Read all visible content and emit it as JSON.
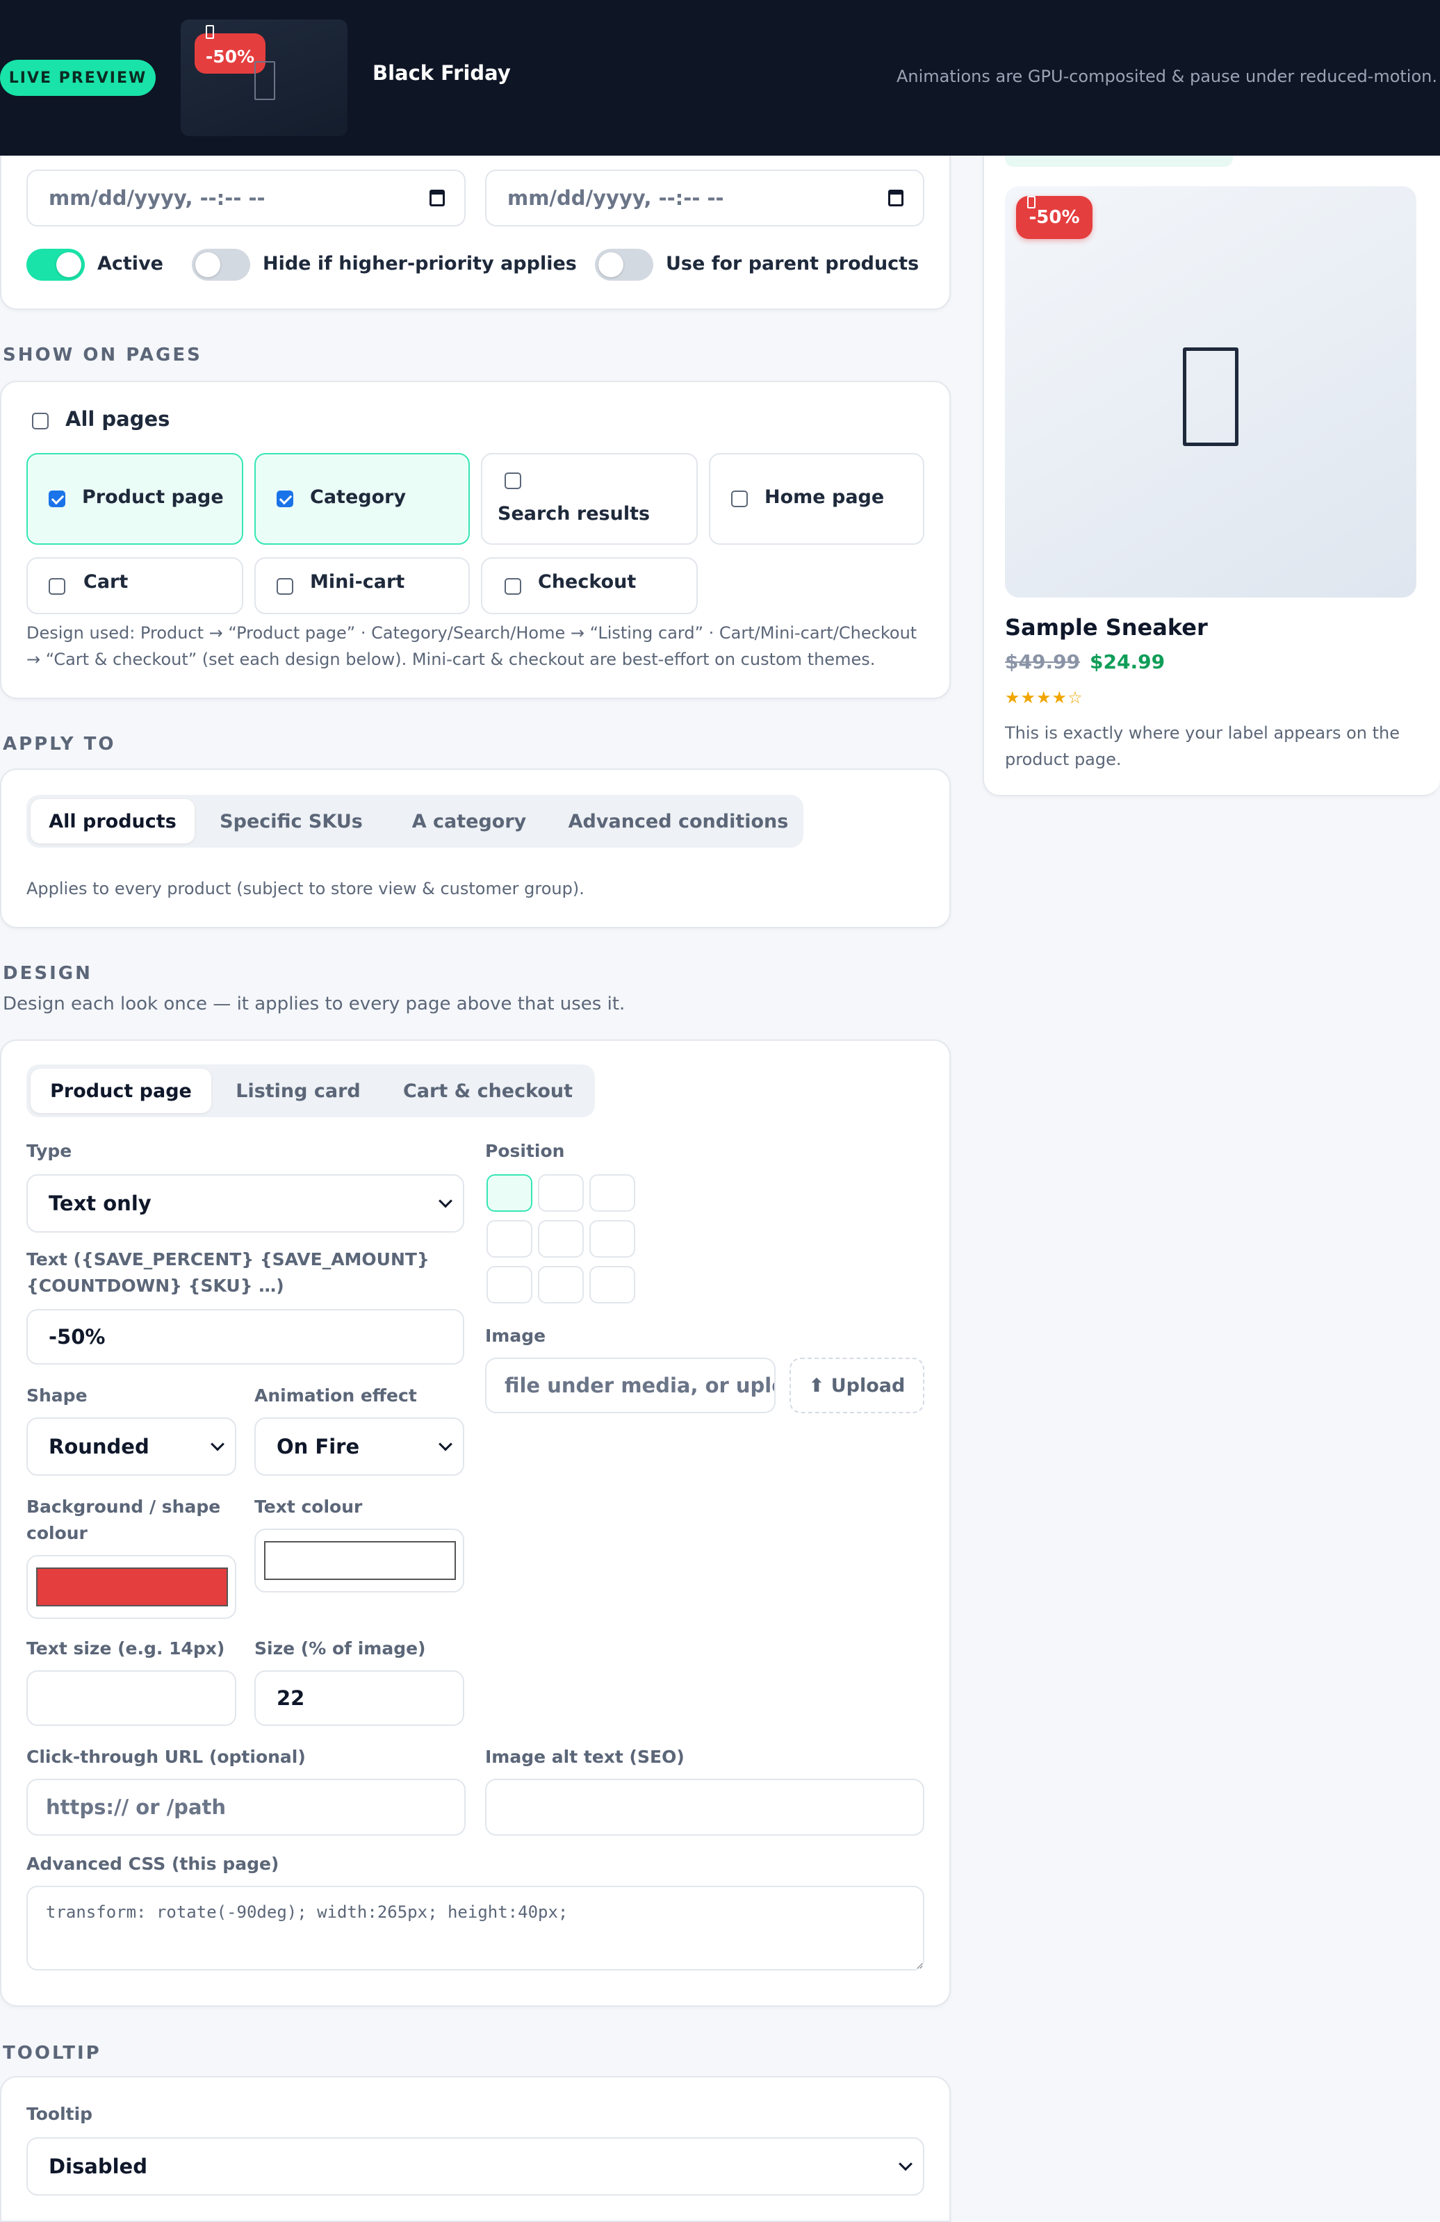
{
  "topbar": {
    "live_label": "LIVE PREVIEW",
    "thumb_badge": "-50%",
    "title": "Black Friday",
    "note": "Animations are GPU-composited & pause under reduced-motion."
  },
  "schedule": {
    "start_placeholder": "mm/dd/yyyy, --:-- --",
    "end_placeholder": "mm/dd/yyyy, --:-- --",
    "toggles": [
      {
        "label": "Active",
        "on": true
      },
      {
        "label": "Hide if higher-priority applies",
        "on": false
      },
      {
        "label": "Use for parent products",
        "on": false
      }
    ]
  },
  "show_on_pages": {
    "heading": "SHOW ON PAGES",
    "all_pages": {
      "label": "All pages",
      "checked": false
    },
    "pages": [
      {
        "label": "Product page",
        "checked": true
      },
      {
        "label": "Category",
        "checked": true
      },
      {
        "label": "Search results",
        "checked": false
      },
      {
        "label": "Home page",
        "checked": false
      },
      {
        "label": "Cart",
        "checked": false
      },
      {
        "label": "Mini-cart",
        "checked": false
      },
      {
        "label": "Checkout",
        "checked": false
      }
    ],
    "help": "Design used: Product → “Product page” · Category/Search/Home → “Listing card” · Cart/Mini-cart/Checkout → “Cart & checkout” (set each design below). Mini-cart & checkout are best-effort on custom themes."
  },
  "apply_to": {
    "heading": "APPLY TO",
    "tabs": [
      "All products",
      "Specific SKUs",
      "A category",
      "Advanced conditions"
    ],
    "active_tab": "All products",
    "help": "Applies to every product (subject to store view & customer group)."
  },
  "design": {
    "heading": "DESIGN",
    "subheading": "Design each look once — it applies to every page above that uses it.",
    "tabs": [
      "Product page",
      "Listing card",
      "Cart & checkout"
    ],
    "active_tab": "Product page",
    "type_label": "Type",
    "type_value": "Text only",
    "text_label": "Text ({SAVE_PERCENT} {SAVE_AMOUNT} {COUNTDOWN} {SKU} …)",
    "text_value": "-50%",
    "shape_label": "Shape",
    "shape_value": "Rounded",
    "animation_label": "Animation effect",
    "animation_value": "On Fire",
    "bg_label": "Background / shape colour",
    "bg_color": "#e53e3e",
    "text_colour_label": "Text colour",
    "text_color": "#ffffff",
    "text_size_label": "Text size (e.g. 14px)",
    "text_size_value": "",
    "size_label": "Size (% of image)",
    "size_value": "22",
    "position_label": "Position",
    "position_selected": "top-left",
    "image_label": "Image",
    "image_placeholder": "file under media, or upload",
    "upload_label": "⬆ Upload",
    "url_label": "Click-through URL (optional)",
    "url_placeholder": "https:// or /path",
    "alt_label": "Image alt text (SEO)",
    "alt_value": "",
    "css_label": "Advanced CSS (this page)",
    "css_value": "transform: rotate(-90deg); width:265px; height:40px;"
  },
  "tooltip": {
    "heading": "TOOLTIP",
    "label": "Tooltip",
    "value": "Disabled"
  },
  "preview": {
    "badge": "-50%",
    "product_name": "Sample Sneaker",
    "old_price": "$49.99",
    "new_price": "$24.99",
    "stars": "★★★★☆",
    "rating": 4,
    "note": "This is exactly where your label appears on the product page.",
    "colors": {
      "badge": "#e53e3e",
      "price": "#0f9d58",
      "stars": "#f0a500"
    }
  }
}
